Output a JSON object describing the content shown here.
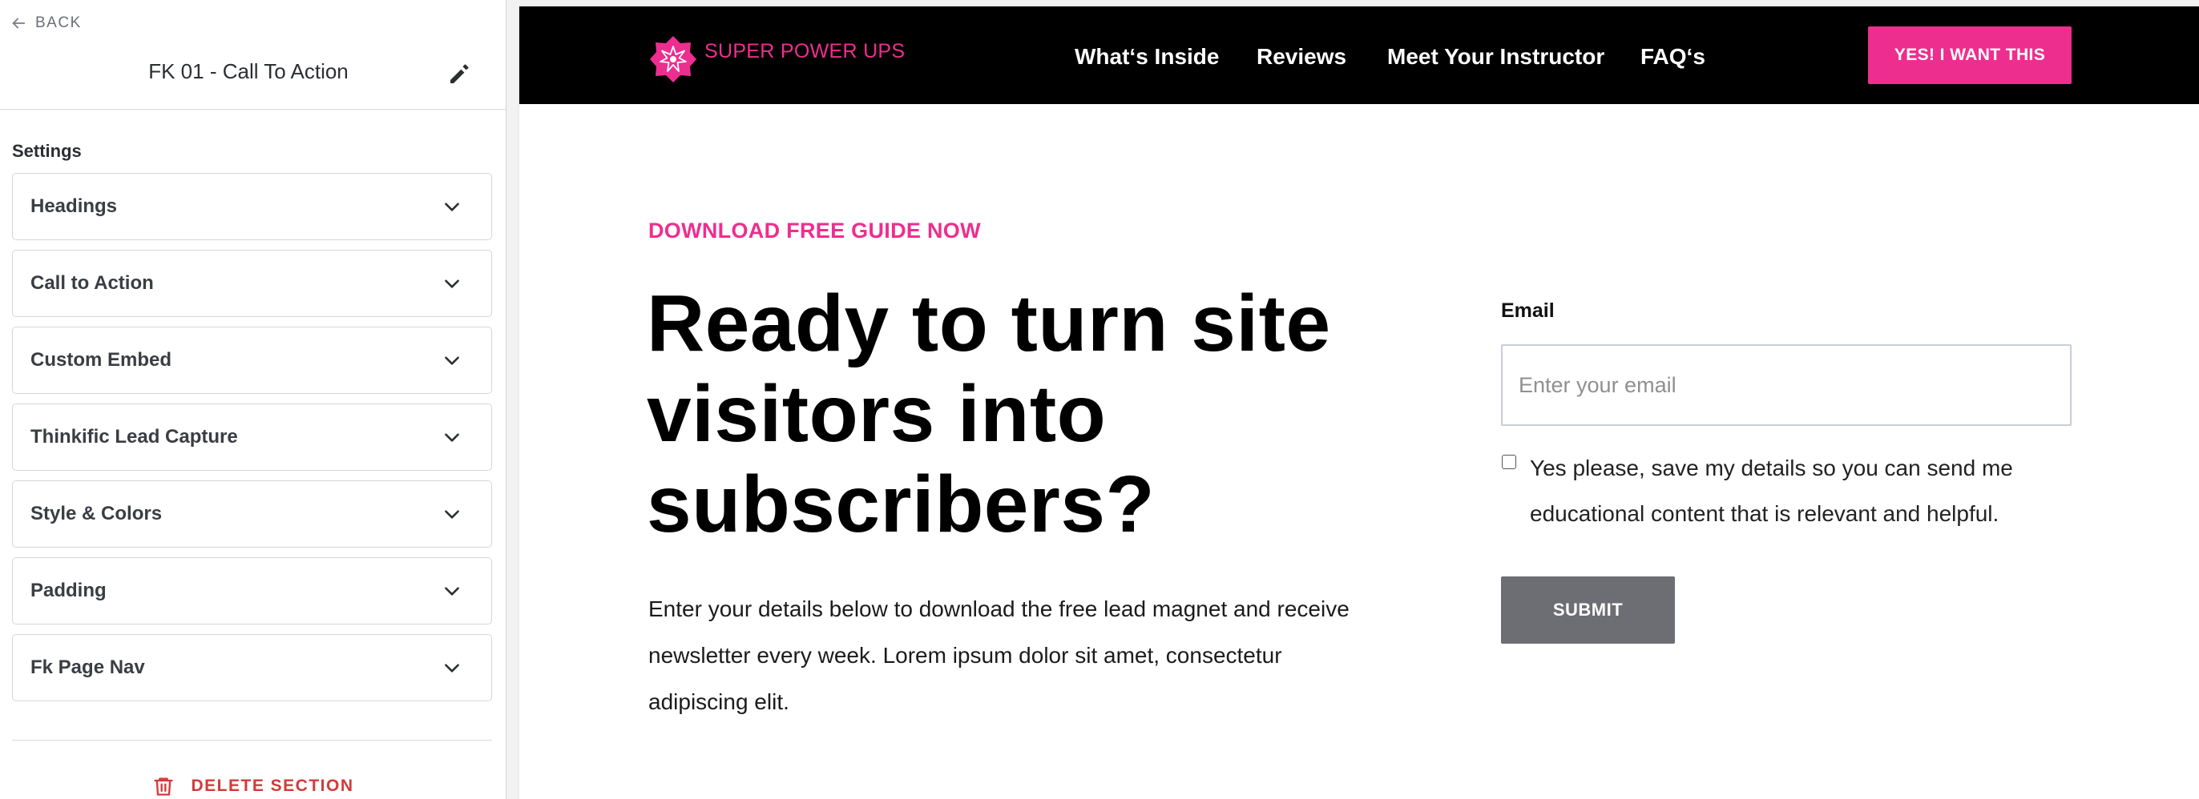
{
  "sidebar": {
    "back_label": "BACK",
    "section_title": "FK 01 - Call To Action",
    "settings_label": "Settings",
    "panels": [
      {
        "label": "Headings"
      },
      {
        "label": "Call to Action"
      },
      {
        "label": "Custom Embed"
      },
      {
        "label": "Thinkific Lead Capture"
      },
      {
        "label": "Style & Colors"
      },
      {
        "label": "Padding"
      },
      {
        "label": "Fk Page Nav"
      }
    ],
    "delete_label": "DELETE SECTION"
  },
  "preview": {
    "brand": {
      "name": "SUPER POWER UPS",
      "color": "#ee2e8f"
    },
    "nav_links": [
      "What‘s Inside",
      "Reviews",
      "Meet Your Instructor",
      "FAQ‘s"
    ],
    "cta_label": "YES! I WANT THIS",
    "eyebrow": "DOWNLOAD FREE GUIDE NOW",
    "headline": "Ready to turn site visitors into subscribers?",
    "body": "Enter your details below to download the free lead magnet and receive newsletter every week. Lorem ipsum dolor sit amet, consectetur adipiscing elit.",
    "form": {
      "email_label": "Email",
      "email_placeholder": "Enter your email",
      "email_value": "",
      "consent_checked": false,
      "consent_text": "Yes please, save my details so you can send me educational content that is relevant and helpful.",
      "submit_label": "SUBMIT"
    }
  },
  "colors": {
    "accent_pink": "#ee2e8f",
    "nav_background": "#000000",
    "submit_gray": "#6d6d74",
    "delete_red": "#d23a3a"
  }
}
